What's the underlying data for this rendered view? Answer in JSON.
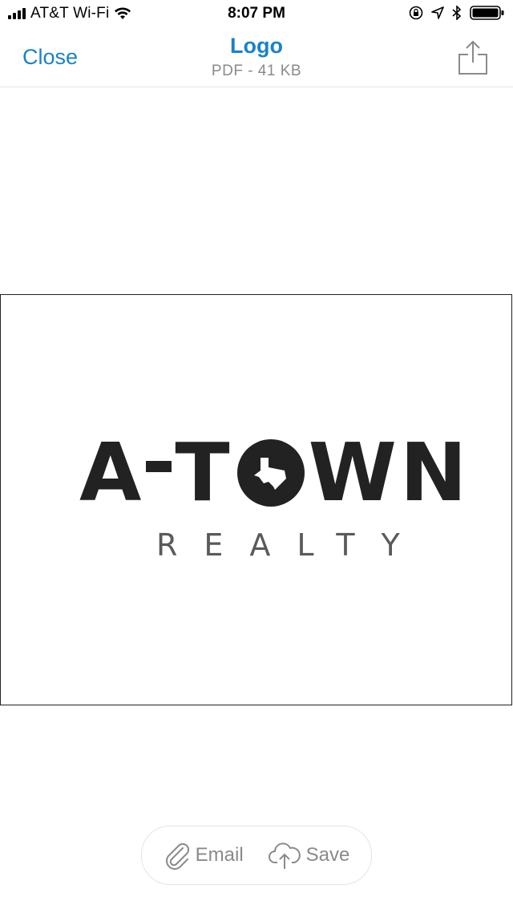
{
  "status_bar": {
    "carrier": "AT&T Wi-Fi",
    "time": "8:07 PM"
  },
  "nav": {
    "close_label": "Close",
    "title": "Logo",
    "subtitle": "PDF - 41 KB"
  },
  "document": {
    "logo_main_left": "A",
    "logo_main_right": "T",
    "logo_main_end": "WN",
    "logo_sub": "REALTY"
  },
  "actions": {
    "email_label": "Email",
    "save_label": "Save"
  },
  "colors": {
    "accent": "#1a82c8",
    "secondary_text": "#8a8a8a",
    "logo_dark": "#222222",
    "logo_gray": "#5a5a5a"
  },
  "icons": {
    "signal": "cellular-signal-icon",
    "wifi": "wifi-icon",
    "lock_rotation": "orientation-lock-icon",
    "location": "location-arrow-icon",
    "bluetooth": "bluetooth-icon",
    "battery": "battery-icon",
    "share": "share-icon",
    "paperclip": "paperclip-icon",
    "cloud_upload": "cloud-upload-icon"
  }
}
